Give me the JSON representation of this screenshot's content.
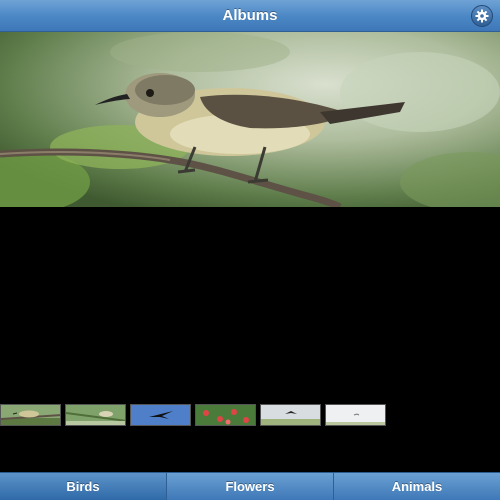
{
  "header": {
    "title": "Albums",
    "settings_icon": "gear-icon"
  },
  "main_photo": {
    "subject": "bird-on-branch"
  },
  "thumbnails": [
    {
      "name": "thumb-bird-branch",
      "icon": "bird"
    },
    {
      "name": "thumb-bird-grass",
      "icon": "bird"
    },
    {
      "name": "thumb-bird-sky",
      "icon": "bird"
    },
    {
      "name": "thumb-flowers",
      "icon": "flower"
    },
    {
      "name": "thumb-bird-field",
      "icon": "bird"
    },
    {
      "name": "thumb-white-field",
      "icon": "bird"
    }
  ],
  "tabs": [
    {
      "label": "Birds",
      "active": true
    },
    {
      "label": "Flowers",
      "active": false
    },
    {
      "label": "Animals",
      "active": false
    }
  ],
  "colors": {
    "header_blue": "#4a86c4",
    "tab_blue": "#3f78b8",
    "background": "#000000"
  }
}
